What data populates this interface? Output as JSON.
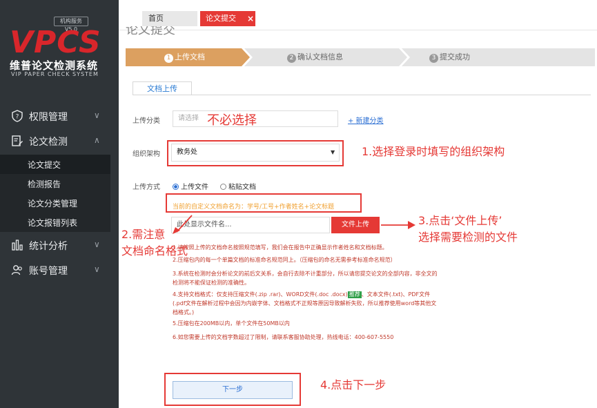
{
  "colors": {
    "accent": "#e53935",
    "sidebar_bg": "#2f3438",
    "link": "#2a6ed3",
    "step_active": "#dca060",
    "step_inactive": "#e4e4e4"
  },
  "logo": {
    "version": "机构服务V5.0",
    "brand": "VPCS",
    "name_cn": "维普论文检测系统",
    "name_en": "VIP PAPER CHECK SYSTEM"
  },
  "sidebar": {
    "items": [
      {
        "label": "权限管理",
        "icon": "shield-icon",
        "expanded": false
      },
      {
        "label": "论文检测",
        "icon": "document-edit-icon",
        "expanded": true
      },
      {
        "label": "统计分析",
        "icon": "bar-chart-icon",
        "expanded": false
      },
      {
        "label": "账号管理",
        "icon": "user-group-icon",
        "expanded": false
      }
    ],
    "sub_items": [
      {
        "label": "论文提交",
        "active": true
      },
      {
        "label": "检测报告",
        "active": false
      },
      {
        "label": "论文分类管理",
        "active": false
      },
      {
        "label": "论文报错列表",
        "active": false
      }
    ]
  },
  "tabs": {
    "home": "首页",
    "active": "论文提交",
    "close": "×"
  },
  "page_title": "论文提交",
  "steps": [
    {
      "num": "1",
      "label": "上传文档",
      "active": true
    },
    {
      "num": "2",
      "label": "确认文档信息",
      "active": false
    },
    {
      "num": "3",
      "label": "提交成功",
      "active": false
    }
  ],
  "form": {
    "subtab": "文档上传",
    "category_label": "上传分类",
    "category_placeholder": "请选择",
    "new_category": "+ 新建分类",
    "org_label": "组织架构",
    "org_value": "教务处",
    "method_label": "上传方式",
    "method_upload": "上传文件",
    "method_paste": "粘贴文档",
    "naming_hint": "当前的自定义文档命名为：学号/工号+作者姓名+论文标题",
    "file_placeholder": "此处显示文件名...",
    "upload_button": "文件上传",
    "next_button": "下一步"
  },
  "notes": {
    "n1": "1.请按照上传的文档命名按照规范填写，我们会在报告中正确显示作者姓名和文档标题。",
    "n2": "2.压缩包内的每一个单篇文档的标准命名规范同上。（压缩包的命名无需参考标准命名规范）",
    "n3": "3.系统在检测时会分析论文的前后文关系，会自行去除不计重部分，所以请您提交论文的全部内容，非全文的检测将不能保证检测的准确性。",
    "n4_a": "4.支持文档格式：仅支持压缩文件(.zip .rar)、WORD文件(.doc .docx)",
    "n4_badge": "推荐",
    "n4_b": "、文本文件(.txt)、PDF文件(.pdf文件在解析过程中会因为内嵌字体、文档格式不正规等原因导致解析失败，所以推荐使用word等其他文档格式。)",
    "n5": "5.压缩包在200MB以内，单个文件在50MB以内",
    "n6": "6.如您需要上传的文档字数超过了限制，请联系客服协助处理，热线电话：400-607-5550"
  },
  "annotations": {
    "not_required": "不必选择",
    "step1": "1.选择登录时填写的组织架构",
    "step2_line1": "2.需注意",
    "step2_line2": "文档命名格式",
    "step3_line1": "3.点击‘文件上传’",
    "step3_line2": "选择需要检测的文件",
    "step4": "4.点击下一步"
  }
}
